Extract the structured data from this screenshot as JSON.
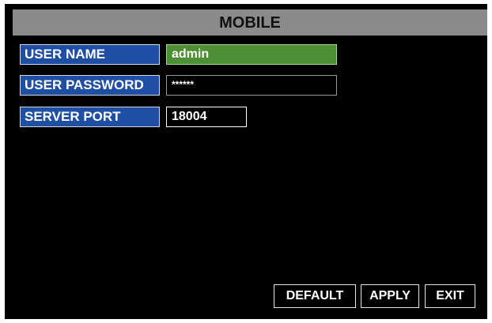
{
  "header": {
    "title": "MOBILE"
  },
  "form": {
    "user_name": {
      "label": "USER NAME",
      "value": "admin"
    },
    "user_password": {
      "label": "USER PASSWORD",
      "value": "******"
    },
    "server_port": {
      "label": "SERVER PORT",
      "value": "18004"
    }
  },
  "buttons": {
    "default_label": "DEFAULT",
    "apply_label": "APPLY",
    "exit_label": "EXIT"
  },
  "colors": {
    "background": "#000000",
    "title_bar": "#8a8a8a",
    "label_bg": "#1f4fa3",
    "selected_field": "#4d8f34"
  }
}
